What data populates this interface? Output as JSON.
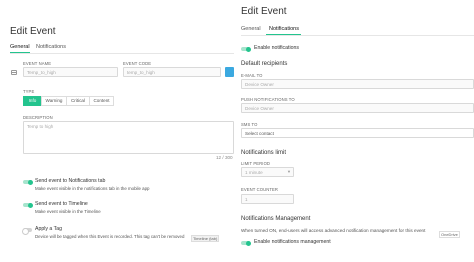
{
  "left": {
    "title": "Edit Event",
    "tabs": [
      {
        "label": "General",
        "active": true
      },
      {
        "label": "Notifications",
        "active": false
      }
    ],
    "event_name": {
      "label": "EVENT NAME",
      "placeholder": "Temp_to_high"
    },
    "event_code": {
      "label": "EVENT CODE",
      "placeholder": "temp_to_high"
    },
    "event_color": "#3ba9e0",
    "type": {
      "label": "TYPE",
      "options": [
        "Info",
        "Warning",
        "Critical",
        "Content"
      ],
      "selected": "Info"
    },
    "description": {
      "label": "DESCRIPTION",
      "placeholder": "Temp to high",
      "counter": "12 / 300"
    },
    "toggles": [
      {
        "label": "Send event to Notifications tab",
        "help": "Make event visible in the notifications tab in the mobile app",
        "on": true
      },
      {
        "label": "Send event to Timeline",
        "help": "Make event visible in the Timeline",
        "on": true
      },
      {
        "label": "Apply a Tag",
        "help": "Device will be tagged when this Event is recorded. This tag can't be removed",
        "on": false
      }
    ],
    "chip": "Timeline (tab)"
  },
  "right": {
    "title": "Edit Event",
    "tabs": [
      {
        "label": "General",
        "active": false
      },
      {
        "label": "Notifications",
        "active": true
      }
    ],
    "enable_notifications": {
      "label": "Enable notifications",
      "on": true
    },
    "default_recipients": {
      "title": "Default recipients",
      "email": {
        "label": "E-MAIL TO",
        "value": "Device Owner"
      },
      "push": {
        "label": "PUSH NOTIFICATIONS TO",
        "value": "Device Owner"
      },
      "sms": {
        "label": "SMS TO",
        "value": "Select contact"
      }
    },
    "limit": {
      "title": "Notifications limit",
      "period_label": "LIMIT PERIOD",
      "period_value": "1 minute",
      "counter_label": "EVENT COUNTER",
      "counter_value": "1"
    },
    "management": {
      "title": "Notifications Management",
      "text": "When turned ON, end-users will access advanced notification management for this event",
      "toggle_label": "Enable notifications management"
    },
    "tooltip": "OneDrive"
  }
}
